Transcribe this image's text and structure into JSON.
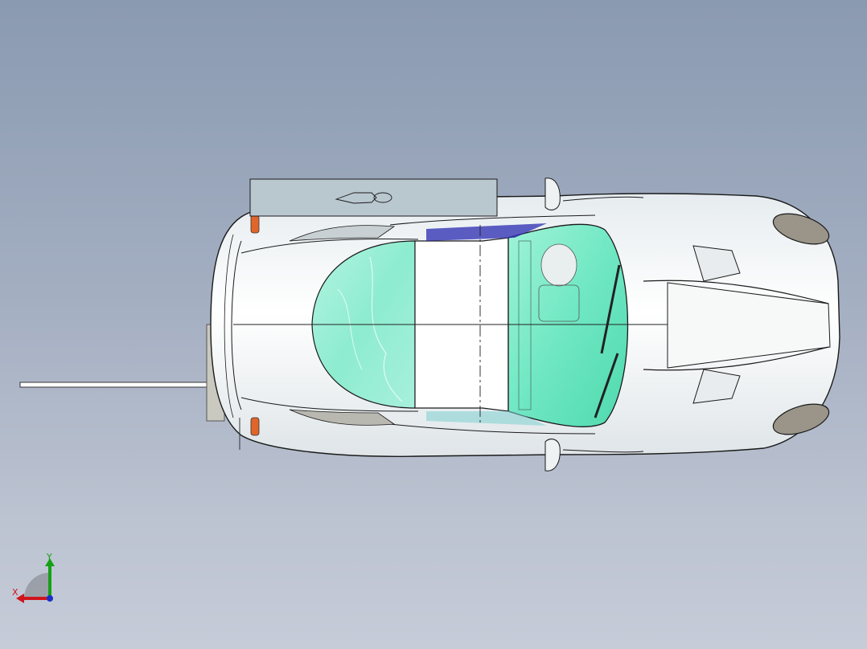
{
  "viewport": {
    "background_top": "#8a9ab1",
    "background_bottom": "#c6ccd8"
  },
  "model": {
    "body_color": "#f2f4f4",
    "glass_color": "#5fe3b9",
    "outline_color": "#1a1a1a",
    "panel_color": "#b9c7cf"
  },
  "triad": {
    "x_label": "X",
    "y_label": "Y",
    "x_color": "#d0141c",
    "y_color": "#16a016",
    "z_color": "#1b2fc8"
  }
}
